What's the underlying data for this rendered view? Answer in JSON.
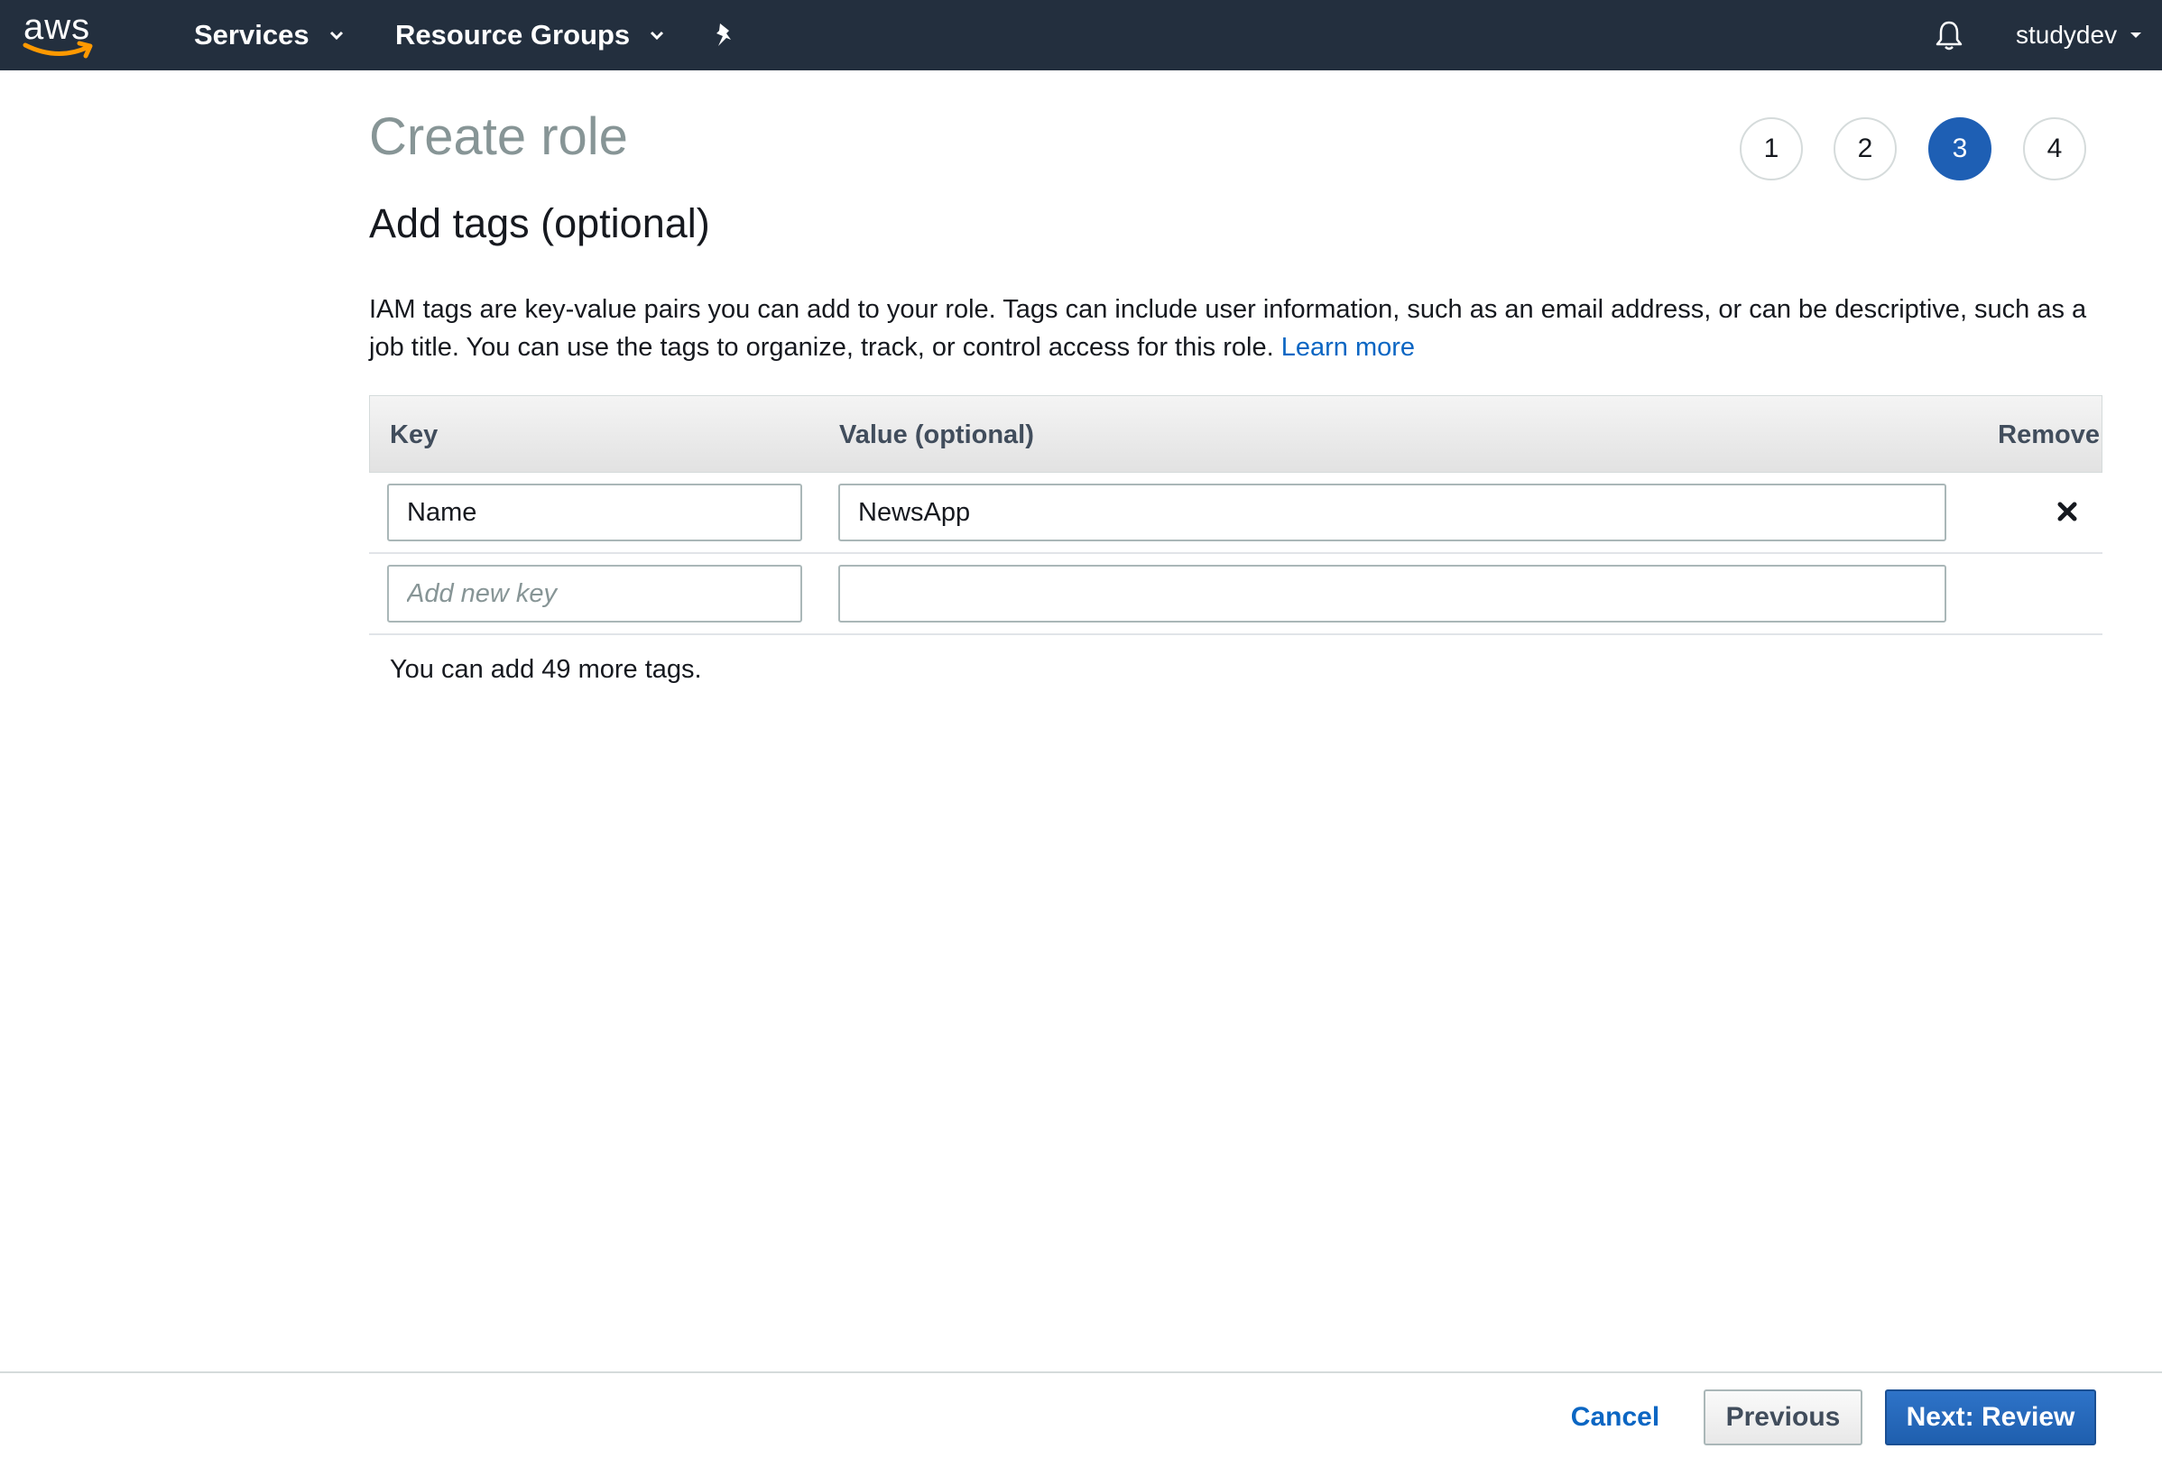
{
  "nav": {
    "logo_text": "aws",
    "services_label": "Services",
    "resource_groups_label": "Resource Groups",
    "username": "studydev",
    "colors": {
      "bar": "#232f3e",
      "logo_smile": "#ff9900"
    }
  },
  "page": {
    "title": "Create role",
    "steps": [
      {
        "label": "1",
        "active": false
      },
      {
        "label": "2",
        "active": false
      },
      {
        "label": "3",
        "active": true
      },
      {
        "label": "4",
        "active": false
      }
    ],
    "section_title": "Add tags (optional)",
    "description": "IAM tags are key-value pairs you can add to your role. Tags can include user information, such as an email address, or can be descriptive, such as a job title. You can use the tags to organize, track, or control access for this role.",
    "learn_more_label": "Learn more"
  },
  "tags_table": {
    "headers": {
      "key": "Key",
      "value": "Value (optional)",
      "remove": "Remove"
    },
    "rows": [
      {
        "key": "Name",
        "value": "NewsApp"
      }
    ],
    "new_row": {
      "key_placeholder": "Add new key",
      "value": ""
    },
    "remaining_text": "You can add 49 more tags."
  },
  "footer": {
    "cancel_label": "Cancel",
    "previous_label": "Previous",
    "next_label": "Next: Review",
    "colors": {
      "primary": "#1e5fb4",
      "link": "#0b66c3"
    }
  }
}
